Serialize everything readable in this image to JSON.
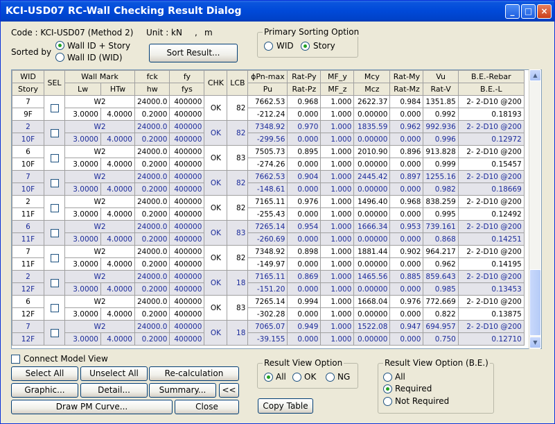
{
  "title": "KCI-USD07 RC-Wall Checking Result Dialog",
  "code_label": "Code : KCI-USD07 (Method 2)",
  "unit_label": "Unit :",
  "unit_force": "kN",
  "unit_sep": ",",
  "unit_length": "m",
  "sorted_by_label": "Sorted by",
  "sort_options": [
    "Wall ID + Story",
    "Wall ID (WID)"
  ],
  "primary_sorting": {
    "legend": "Primary Sorting Option",
    "options": [
      "WID",
      "Story"
    ]
  },
  "sort_button": "Sort Result...",
  "headers_top": [
    "WID",
    "SEL",
    "Wall Mark",
    "fck",
    "fy",
    "CHK",
    "LCB",
    "ϕPn-max",
    "Rat-Py",
    "MF_y",
    "Mcy",
    "Rat-My",
    "Vu",
    "B.E.-Rebar"
  ],
  "headers_bottom": [
    "Story",
    "Lw",
    "HTw",
    "hw",
    "fys",
    "Pu",
    "Rat-Pz",
    "MF_z",
    "Mcz",
    "Rat-Mz",
    "Rat-V",
    "B.E.-L"
  ],
  "rows": [
    {
      "wid": "7",
      "story": "9F",
      "mark": "W2",
      "lw": "3.0000",
      "htw": "4.0000",
      "fck": "24000.0",
      "hw": "0.2000",
      "fy": "400000",
      "fys": "400000",
      "chk": "OK",
      "lcb": "82",
      "pnmax": "7662.53",
      "pu": "-212.24",
      "ratpy": "0.968",
      "ratpz": "0.000",
      "mfy": "1.000",
      "mfz": "1.000",
      "mcy": "2622.37",
      "mcz": "0.00000",
      "ratmy": "0.984",
      "ratmz": "0.000",
      "vu": "1351.85",
      "ratv": "0.992",
      "rebar": "2- 2-D10 @200",
      "bel": "0.18193"
    },
    {
      "wid": "2",
      "story": "10F",
      "mark": "W2",
      "lw": "3.0000",
      "htw": "4.0000",
      "fck": "24000.0",
      "hw": "0.2000",
      "fy": "400000",
      "fys": "400000",
      "chk": "OK",
      "lcb": "82",
      "pnmax": "7348.92",
      "pu": "-299.56",
      "ratpy": "0.970",
      "ratpz": "0.000",
      "mfy": "1.000",
      "mfz": "1.000",
      "mcy": "1835.59",
      "mcz": "0.00000",
      "ratmy": "0.962",
      "ratmz": "0.000",
      "vu": "992.936",
      "ratv": "0.996",
      "rebar": "2- 2-D10 @200",
      "bel": "0.12972"
    },
    {
      "wid": "6",
      "story": "10F",
      "mark": "W2",
      "lw": "3.0000",
      "htw": "4.0000",
      "fck": "24000.0",
      "hw": "0.2000",
      "fy": "400000",
      "fys": "400000",
      "chk": "OK",
      "lcb": "83",
      "pnmax": "7505.73",
      "pu": "-274.26",
      "ratpy": "0.895",
      "ratpz": "0.000",
      "mfy": "1.000",
      "mfz": "1.000",
      "mcy": "2010.90",
      "mcz": "0.00000",
      "ratmy": "0.896",
      "ratmz": "0.000",
      "vu": "913.828",
      "ratv": "0.999",
      "rebar": "2- 2-D10 @200",
      "bel": "0.15457"
    },
    {
      "wid": "7",
      "story": "10F",
      "mark": "W2",
      "lw": "3.0000",
      "htw": "4.0000",
      "fck": "24000.0",
      "hw": "0.2000",
      "fy": "400000",
      "fys": "400000",
      "chk": "OK",
      "lcb": "82",
      "pnmax": "7662.53",
      "pu": "-148.61",
      "ratpy": "0.904",
      "ratpz": "0.000",
      "mfy": "1.000",
      "mfz": "1.000",
      "mcy": "2445.42",
      "mcz": "0.00000",
      "ratmy": "0.897",
      "ratmz": "0.000",
      "vu": "1255.16",
      "ratv": "0.982",
      "rebar": "2- 2-D10 @200",
      "bel": "0.18669"
    },
    {
      "wid": "2",
      "story": "11F",
      "mark": "W2",
      "lw": "3.0000",
      "htw": "4.0000",
      "fck": "24000.0",
      "hw": "0.2000",
      "fy": "400000",
      "fys": "400000",
      "chk": "OK",
      "lcb": "82",
      "pnmax": "7165.11",
      "pu": "-255.43",
      "ratpy": "0.976",
      "ratpz": "0.000",
      "mfy": "1.000",
      "mfz": "1.000",
      "mcy": "1496.40",
      "mcz": "0.00000",
      "ratmy": "0.968",
      "ratmz": "0.000",
      "vu": "838.259",
      "ratv": "0.995",
      "rebar": "2- 2-D10 @200",
      "bel": "0.12492"
    },
    {
      "wid": "6",
      "story": "11F",
      "mark": "W2",
      "lw": "3.0000",
      "htw": "4.0000",
      "fck": "24000.0",
      "hw": "0.2000",
      "fy": "400000",
      "fys": "400000",
      "chk": "OK",
      "lcb": "83",
      "pnmax": "7265.14",
      "pu": "-260.69",
      "ratpy": "0.954",
      "ratpz": "0.000",
      "mfy": "1.000",
      "mfz": "1.000",
      "mcy": "1666.34",
      "mcz": "0.00000",
      "ratmy": "0.953",
      "ratmz": "0.000",
      "vu": "739.161",
      "ratv": "0.868",
      "rebar": "2- 2-D10 @200",
      "bel": "0.14251"
    },
    {
      "wid": "7",
      "story": "11F",
      "mark": "W2",
      "lw": "3.0000",
      "htw": "4.0000",
      "fck": "24000.0",
      "hw": "0.2000",
      "fy": "400000",
      "fys": "400000",
      "chk": "OK",
      "lcb": "82",
      "pnmax": "7348.92",
      "pu": "-149.97",
      "ratpy": "0.898",
      "ratpz": "0.000",
      "mfy": "1.000",
      "mfz": "1.000",
      "mcy": "1881.44",
      "mcz": "0.00000",
      "ratmy": "0.902",
      "ratmz": "0.000",
      "vu": "964.217",
      "ratv": "0.962",
      "rebar": "2- 2-D10 @200",
      "bel": "0.14195"
    },
    {
      "wid": "2",
      "story": "12F",
      "mark": "W2",
      "lw": "3.0000",
      "htw": "4.0000",
      "fck": "24000.0",
      "hw": "0.2000",
      "fy": "400000",
      "fys": "400000",
      "chk": "OK",
      "lcb": "18",
      "pnmax": "7165.11",
      "pu": "-151.20",
      "ratpy": "0.869",
      "ratpz": "0.000",
      "mfy": "1.000",
      "mfz": "1.000",
      "mcy": "1465.56",
      "mcz": "0.00000",
      "ratmy": "0.885",
      "ratmz": "0.000",
      "vu": "859.643",
      "ratv": "0.985",
      "rebar": "2- 2-D10 @200",
      "bel": "0.13453"
    },
    {
      "wid": "6",
      "story": "12F",
      "mark": "W2",
      "lw": "3.0000",
      "htw": "4.0000",
      "fck": "24000.0",
      "hw": "0.2000",
      "fy": "400000",
      "fys": "400000",
      "chk": "OK",
      "lcb": "83",
      "pnmax": "7265.14",
      "pu": "-302.28",
      "ratpy": "0.994",
      "ratpz": "0.000",
      "mfy": "1.000",
      "mfz": "1.000",
      "mcy": "1668.04",
      "mcz": "0.00000",
      "ratmy": "0.976",
      "ratmz": "0.000",
      "vu": "772.669",
      "ratv": "0.822",
      "rebar": "2- 2-D10 @200",
      "bel": "0.13875"
    },
    {
      "wid": "7",
      "story": "12F",
      "mark": "W2",
      "lw": "3.0000",
      "htw": "4.0000",
      "fck": "24000.0",
      "hw": "0.2000",
      "fy": "400000",
      "fys": "400000",
      "chk": "OK",
      "lcb": "18",
      "pnmax": "7065.07",
      "pu": "-39.155",
      "ratpy": "0.949",
      "ratpz": "0.000",
      "mfy": "1.000",
      "mfz": "1.000",
      "mcy": "1522.08",
      "mcz": "0.00000",
      "ratmy": "0.947",
      "ratmz": "0.000",
      "vu": "694.957",
      "ratv": "0.750",
      "rebar": "2- 2-D10 @200",
      "bel": "0.12710"
    }
  ],
  "connect_model_view": "Connect Model View",
  "buttons": {
    "select_all": "Select All",
    "unselect_all": "Unselect All",
    "recalc": "Re-calculation",
    "graphic": "Graphic...",
    "detail": "Detail...",
    "summary": "Summary...",
    "collapse": "<<",
    "draw_pm": "Draw PM Curve...",
    "close": "Close",
    "copy_table": "Copy Table"
  },
  "result_view": {
    "legend": "Result View Option",
    "options": [
      "All",
      "OK",
      "NG"
    ]
  },
  "result_view_be": {
    "legend": "Result View Option (B.E.)",
    "options": [
      "All",
      "Required",
      "Not Required"
    ]
  },
  "colors": {
    "title_bar": "#0049d8",
    "alt_row": "#e4e4ea",
    "alt_text": "#1a2a9a"
  }
}
